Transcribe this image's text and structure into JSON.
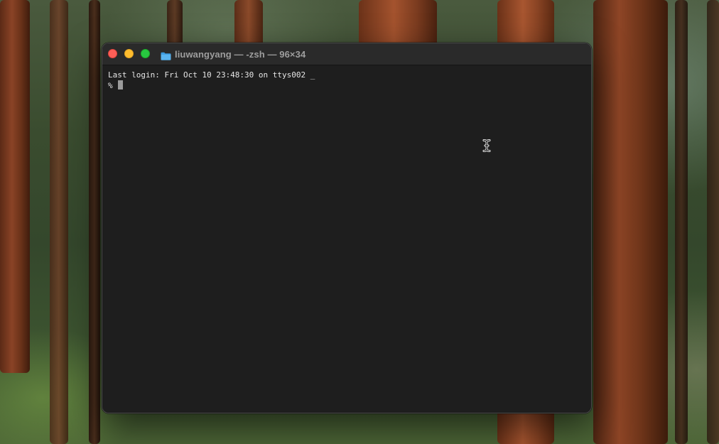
{
  "desktop": {
    "wallpaper": "forest-redwoods"
  },
  "window": {
    "title": "liuwangyang — -zsh — 96×34",
    "title_icon": "folder-icon",
    "controls": {
      "close_color": "#fe5f57",
      "minimize_color": "#febc2e",
      "zoom_color": "#28c840"
    }
  },
  "terminal": {
    "last_login": "Last login: Fri Oct 10 23:48:30 on ttys002 _",
    "prompt": "%"
  },
  "pointer": {
    "type": "ibeam-cursor-icon"
  }
}
